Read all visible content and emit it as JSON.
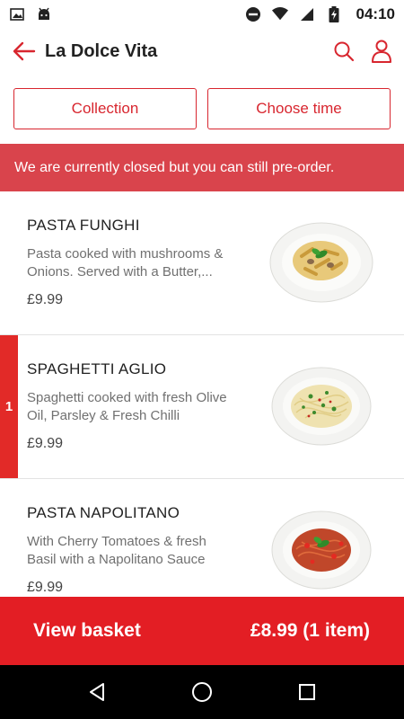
{
  "status_bar": {
    "time": "04:10",
    "left_icons": [
      "gallery-icon",
      "android-icon"
    ],
    "right_icons": [
      "do-not-disturb-icon",
      "wifi-icon",
      "signal-icon",
      "battery-charging-icon"
    ]
  },
  "app_bar": {
    "title": "La Dolce Vita",
    "back_icon": "arrow-left-icon",
    "search_icon": "search-icon",
    "account_icon": "person-icon"
  },
  "order_modes": {
    "collection_label": "Collection",
    "choose_time_label": "Choose time"
  },
  "notice": {
    "text": "We are currently closed but you can still pre-order."
  },
  "menu_items": [
    {
      "name": "PASTA FUNGHI",
      "description_line1": "Pasta cooked with mushrooms &",
      "description_line2": "Onions. Served with a Butter,...",
      "price": "£9.99",
      "quantity": ""
    },
    {
      "name": "SPAGHETTI AGLIO",
      "description_line1": "Spaghetti cooked with fresh Olive",
      "description_line2": "Oil, Parsley & Fresh Chilli",
      "price": "£9.99",
      "quantity": "1"
    },
    {
      "name": "PASTA NAPOLITANO",
      "description_line1": "With Cherry Tomatoes & fresh",
      "description_line2": "Basil with a Napolitano Sauce",
      "price": "£9.99",
      "quantity": ""
    }
  ],
  "basket": {
    "label": "View basket",
    "total": "£8.99 (1 item)"
  },
  "nav_bar": {
    "icons": [
      "back-triangle-icon",
      "home-circle-icon",
      "recents-square-icon"
    ]
  },
  "colors": {
    "accent": "#d8262f",
    "banner": "#d9444c",
    "basket_bar": "#e31e24",
    "quantity_marker": "#e22a28"
  }
}
